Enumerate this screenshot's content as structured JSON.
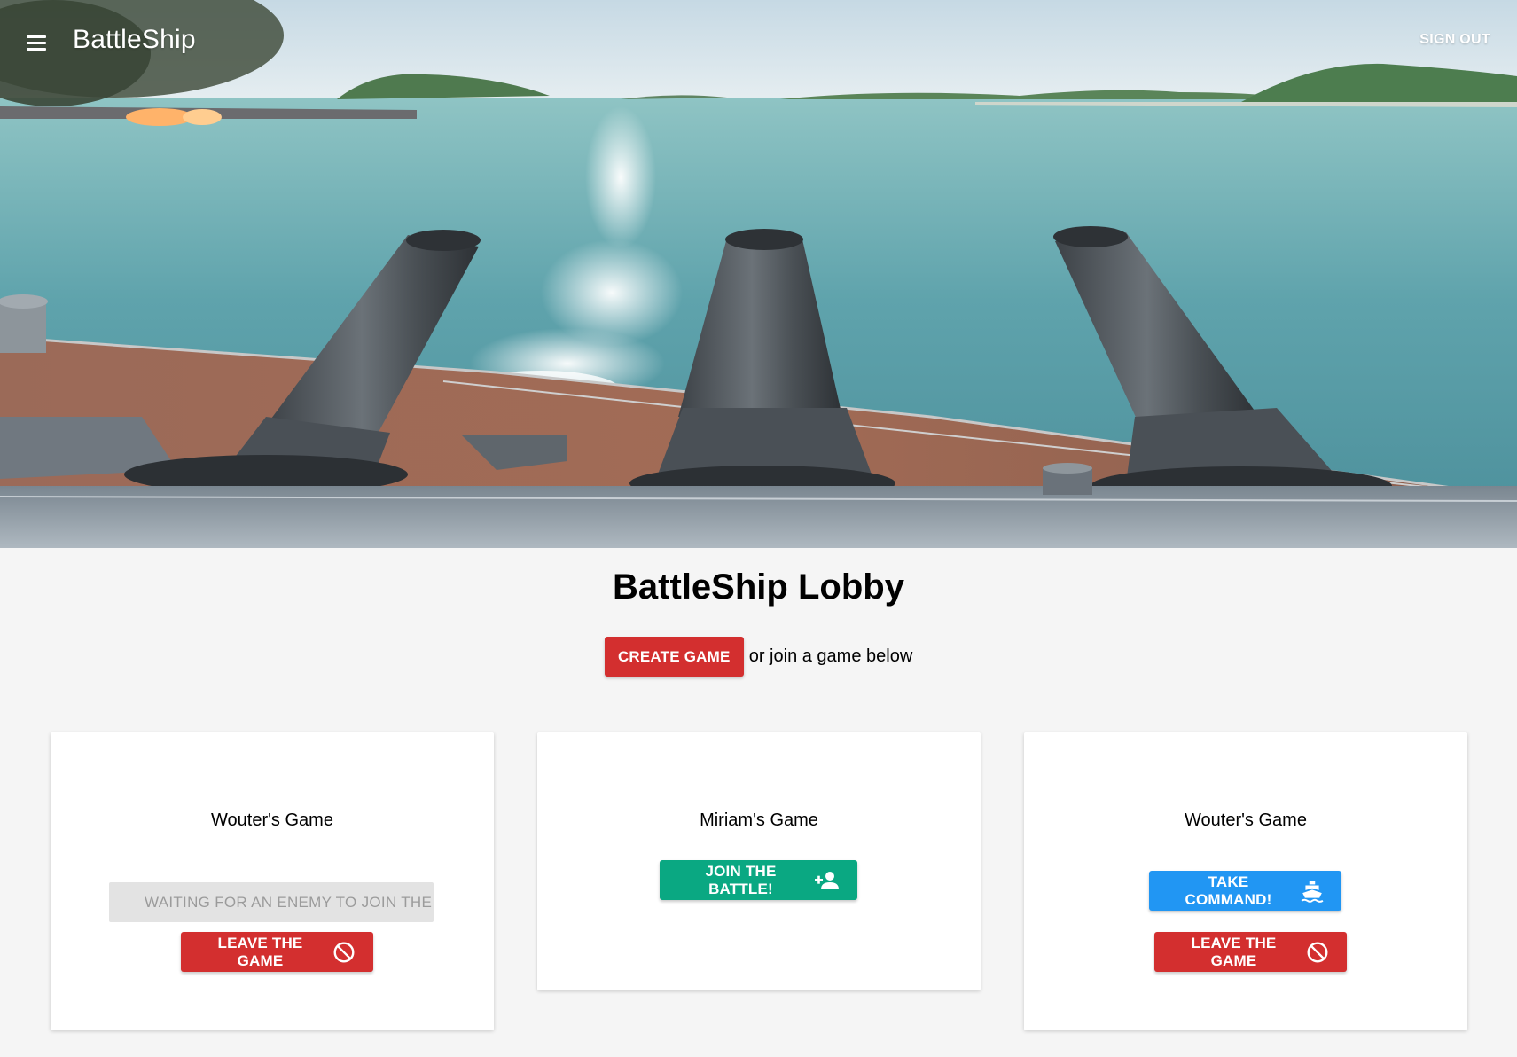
{
  "appbar": {
    "title": "BattleShip",
    "menu_icon": "hamburger-menu-icon",
    "signout_label": "SIGN OUT"
  },
  "hero": {
    "image": "battleship-cannons-ocean-photo"
  },
  "lobby": {
    "title": "BattleShip Lobby",
    "create_label": "CREATE GAME",
    "create_suffix": "or join a game below"
  },
  "games": [
    {
      "title": "Wouter's Game",
      "waiting_label": "WAITING FOR AN ENEMY TO JOIN THE",
      "leave_label": "LEAVE THE GAME",
      "leave_icon": "block-icon"
    },
    {
      "title": "Miriam's Game",
      "join_label": "JOIN THE BATTLE!",
      "join_icon": "person-add-icon"
    },
    {
      "title": "Wouter's Game",
      "take_label": "TAKE COMMAND!",
      "take_icon": "ship-icon",
      "leave_label": "LEAVE THE GAME",
      "leave_icon": "block-icon"
    }
  ],
  "colors": {
    "red": "#d32f2f",
    "green": "#0aa882",
    "blue": "#2196f3",
    "background": "#f5f5f5"
  }
}
